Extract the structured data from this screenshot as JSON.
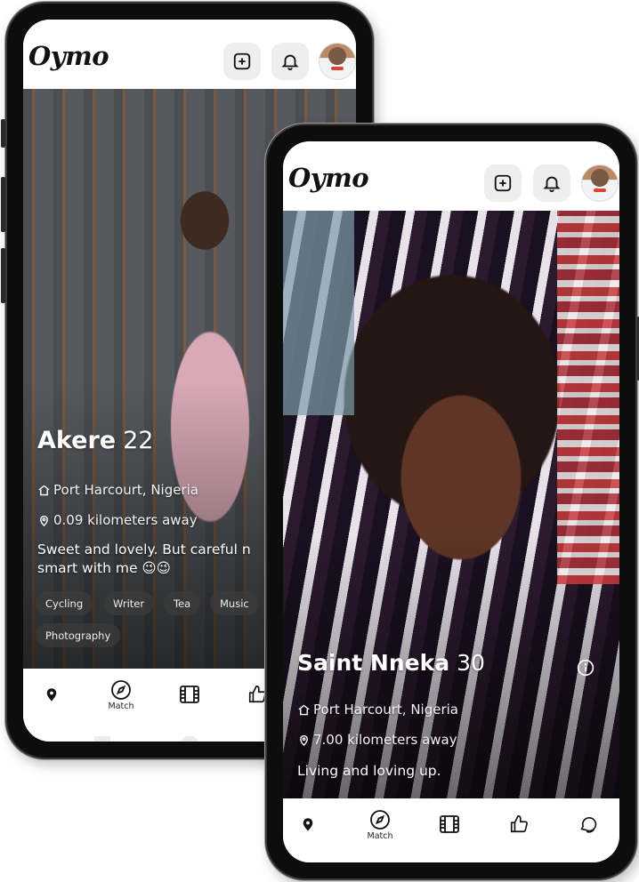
{
  "app": {
    "logo": "Oymo"
  },
  "back_phone": {
    "profile": {
      "name": "Akere",
      "age": "22",
      "location": "Port Harcourt, Nigeria",
      "distance": "0.09 kilometers away",
      "bio_line1": "Sweet and lovely. But careful n",
      "bio_line2": "smart with me 😉😉",
      "interests": [
        "Cycling",
        "Writer",
        "Tea",
        "Music",
        "Photography"
      ]
    },
    "tabs": {
      "match": "Match"
    }
  },
  "front_phone": {
    "profile": {
      "name": "Saint Nneka",
      "age": "30",
      "location": "Port Harcourt, Nigeria",
      "distance": "7.00 kilometers away",
      "bio": "Living and loving up."
    },
    "tabs": {
      "match": "Match"
    }
  },
  "icons": {
    "add": "add-square-icon",
    "bell": "bell-icon",
    "pin": "map-pin-icon",
    "compass": "compass-icon",
    "film": "film-icon",
    "like": "thumbs-up-icon",
    "chat": "chat-bubble-icon",
    "home": "home-icon",
    "info": "info-icon"
  }
}
